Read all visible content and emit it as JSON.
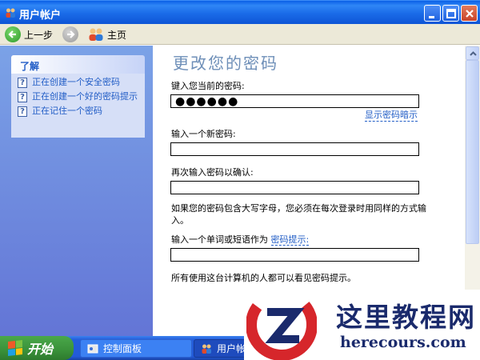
{
  "window": {
    "title": "用户帐户"
  },
  "toolbar": {
    "back_label": "上一步",
    "home_label": "主页"
  },
  "sidebar": {
    "header": "了解",
    "items": [
      {
        "label": "正在创建一个安全密码"
      },
      {
        "label": "正在创建一个好的密码提示"
      },
      {
        "label": "正在记住一个密码"
      }
    ]
  },
  "main": {
    "title": "更改您的密码",
    "current_label": "键入您当前的密码:",
    "current_value": "●●●●●●",
    "show_hint": "显示密码暗示",
    "new_label": "输入一个新密码:",
    "confirm_label": "再次输入密码以确认:",
    "case_note": "如果您的密码包含大写字母，您必须在每次登录时用同样的方式输入。",
    "hint_prefix": "输入一个单词或短语作为",
    "hint_link": "密码提示:",
    "footer_note": "所有使用这台计算机的人都可以看见密码提示。"
  },
  "taskbar": {
    "start_label": "开始",
    "tasks": [
      {
        "label": "控制面板"
      },
      {
        "label": "用户帐户"
      }
    ]
  },
  "watermark": {
    "text": "这里教程网",
    "url": "herecours.com"
  },
  "colors": {
    "title_blue": "#0a5fe6",
    "link_blue": "#215dc6",
    "start_green": "#3a913a",
    "task_pane": "#7ba2e7"
  }
}
